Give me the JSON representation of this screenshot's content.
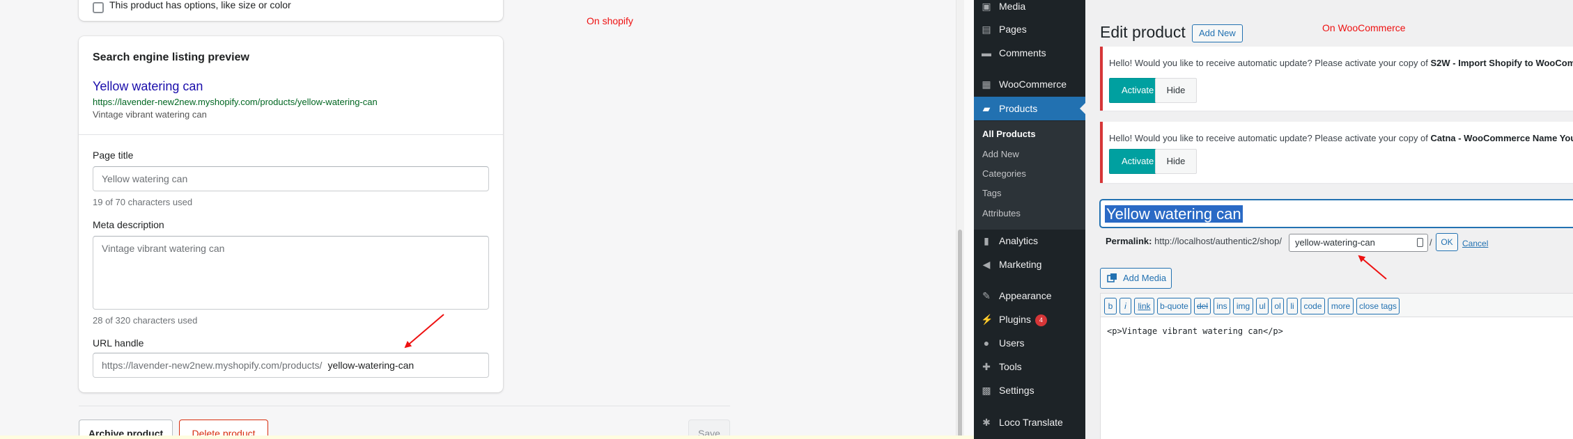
{
  "shopify": {
    "options_checkbox_label": "This product has options, like size or color",
    "seo_card": {
      "title": "Search engine listing preview",
      "preview_title": "Yellow watering can",
      "preview_url": "https://lavender-new2new.myshopify.com/products/yellow-watering-can",
      "preview_description": "Vintage vibrant watering can",
      "page_title_label": "Page title",
      "page_title_value": "Yellow watering can",
      "page_title_hint": "19 of 70 characters used",
      "meta_label": "Meta description",
      "meta_value": "Vintage vibrant watering can",
      "meta_hint": "28 of 320 characters used",
      "url_label": "URL handle",
      "url_prefix": "https://lavender-new2new.myshopify.com/products/",
      "url_handle": "yellow-watering-can"
    },
    "buttons": {
      "archive": "Archive product",
      "delete": "Delete product",
      "save": "Save"
    },
    "annotation": "On shopify",
    "annotation_color": "#e11111"
  },
  "wp": {
    "menu": [
      {
        "label": "Media",
        "icon": "media-icon"
      },
      {
        "label": "Pages",
        "icon": "pages-icon"
      },
      {
        "label": "Comments",
        "icon": "comments-icon"
      },
      {
        "label": "WooCommerce",
        "icon": "woocommerce-icon"
      },
      {
        "label": "Products",
        "icon": "products-icon"
      },
      {
        "label": "Analytics",
        "icon": "analytics-icon"
      },
      {
        "label": "Marketing",
        "icon": "marketing-icon"
      },
      {
        "label": "Appearance",
        "icon": "appearance-icon"
      },
      {
        "label": "Plugins",
        "icon": "plugins-icon",
        "badge": "4"
      },
      {
        "label": "Users",
        "icon": "users-icon"
      },
      {
        "label": "Tools",
        "icon": "tools-icon"
      },
      {
        "label": "Settings",
        "icon": "settings-icon"
      },
      {
        "label": "Loco Translate",
        "icon": "loco-translate-icon"
      }
    ],
    "submenu": [
      "All Products",
      "Add New",
      "Categories",
      "Tags",
      "Attributes"
    ],
    "accent": "#2271b1"
  },
  "woo": {
    "heading": "Edit product",
    "add_new": "Add New",
    "annotation": "On WooCommerce",
    "notice1": {
      "text_prefix": "Hello! Would you like to receive automatic update? Please activate your copy of ",
      "plugin": "S2W - Import Shopify to WooCom"
    },
    "notice2": {
      "text_prefix": "Hello! Would you like to receive automatic update? Please activate your copy of ",
      "plugin": "Catna - WooCommerce Name You"
    },
    "activate": "Activate",
    "hide": "Hide",
    "title_value": "Yellow watering can",
    "permalink_label": "Permalink:",
    "permalink_base": "http://localhost/authentic2/shop/",
    "slug": "yellow-watering-can",
    "slash": "/",
    "ok": "OK",
    "cancel": "Cancel",
    "add_media": "Add Media",
    "quicktags": [
      "b",
      "i",
      "link",
      "b-quote",
      "del",
      "ins",
      "img",
      "ul",
      "ol",
      "li",
      "code",
      "more",
      "close tags"
    ],
    "content": "<p>Vintage vibrant watering can</p>"
  }
}
